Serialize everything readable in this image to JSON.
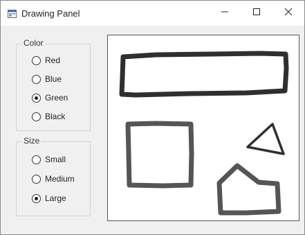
{
  "window": {
    "title": "Drawing Panel",
    "icon": "drawing-app-icon"
  },
  "titlebar_buttons": {
    "minimize_icon": "minimize-icon",
    "maximize_icon": "maximize-icon",
    "close_icon": "close-icon"
  },
  "color_group": {
    "legend": "Color",
    "options": [
      {
        "label": "Red",
        "checked": false
      },
      {
        "label": "Blue",
        "checked": false
      },
      {
        "label": "Green",
        "checked": true
      },
      {
        "label": "Black",
        "checked": false
      }
    ]
  },
  "size_group": {
    "legend": "Size",
    "options": [
      {
        "label": "Small",
        "checked": false
      },
      {
        "label": "Medium",
        "checked": false
      },
      {
        "label": "Large",
        "checked": true
      }
    ]
  },
  "canvas": {
    "stroke_colors": {
      "dark": "#2f2f2f",
      "gray": "#555555"
    }
  }
}
